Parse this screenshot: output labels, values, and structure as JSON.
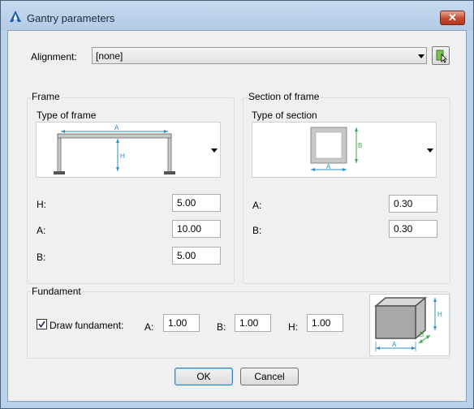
{
  "window": {
    "title": "Gantry parameters"
  },
  "alignment": {
    "label": "Alignment:",
    "value": "[none]"
  },
  "frame": {
    "group_label": "Frame",
    "type_label": "Type of frame",
    "fields": [
      {
        "label": "H:",
        "value": "5.00"
      },
      {
        "label": "A:",
        "value": "10.00"
      },
      {
        "label": "B:",
        "value": "5.00"
      }
    ],
    "diagram": {
      "dim_a": "A",
      "dim_h": "H"
    }
  },
  "section": {
    "group_label": "Section of frame",
    "type_label": "Type of section",
    "fields": [
      {
        "label": "A:",
        "value": "0.30"
      },
      {
        "label": "B:",
        "value": "0.30"
      }
    ],
    "diagram": {
      "dim_a": "A",
      "dim_b": "B"
    }
  },
  "fundament": {
    "group_label": "Fundament",
    "draw_label": "Draw fundament:",
    "draw_checked": true,
    "fields": [
      {
        "label": "A:",
        "value": "1.00"
      },
      {
        "label": "B:",
        "value": "1.00"
      },
      {
        "label": "H:",
        "value": "1.00"
      }
    ],
    "diagram": {
      "dim_a": "A",
      "dim_b": "B",
      "dim_h": "H"
    }
  },
  "buttons": {
    "ok": "OK",
    "cancel": "Cancel"
  },
  "colors": {
    "dim_blue": "#2a8fc4",
    "dim_green": "#3aa64a",
    "accent": "#1f5fa8"
  },
  "icons": [
    "app-logo-icon",
    "close-icon",
    "dropdown-arrow-icon",
    "pick-from-drawing-icon",
    "checkmark-icon"
  ]
}
